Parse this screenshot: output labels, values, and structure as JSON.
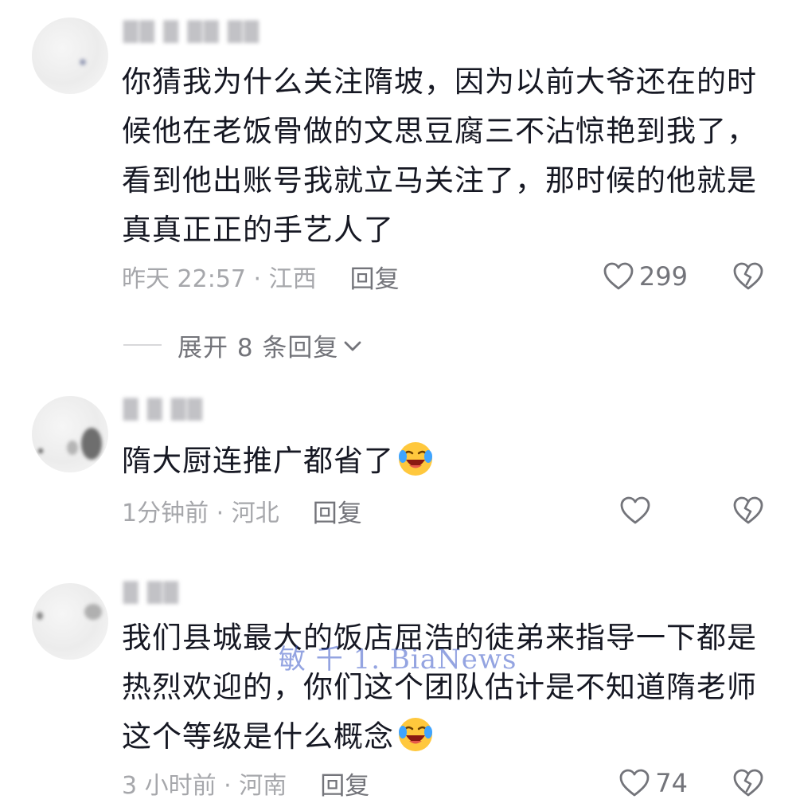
{
  "comments": [
    {
      "username": "██ █ ██ ██",
      "lines": [
        "你猜我为什么关注隋坡，因为以前大爷还在的时",
        "候他在老饭骨做的文思豆腐三不沾惊艳到我了，",
        "看到他出账号我就立马关注了，那时候的他就是",
        "真真正正的手艺人了"
      ],
      "time_location": "昨天 22:57 · 江西",
      "reply_label": "回复",
      "like_count": "299"
    },
    {
      "username": "█ █ ██",
      "lines": [
        "隋大厨连推广都省了"
      ],
      "time_location": "1分钟前 · 河北",
      "reply_label": "回复",
      "like_count": ""
    },
    {
      "username": "█ ██",
      "lines": [
        "我们县城最大的饭店屈浩的徒弟来指导一下都是",
        "热烈欢迎的，你们这个团队估计是不知道隋老师",
        "这个等级是什么概念"
      ],
      "time_location": "3 小时前 · 河南",
      "reply_label": "回复",
      "like_count": "74"
    }
  ],
  "expand_replies_label": "展开 8 条回复",
  "watermark": "敏 千 1. BiaNews",
  "icons": {
    "like": "heart-outline-icon",
    "dislike": "broken-heart-icon",
    "emoji": "laughing-crying-emoji-icon",
    "expand": "chevron-down-icon"
  },
  "colors": {
    "text_primary": "#161823",
    "text_meta": "#a6a7ab",
    "text_action": "#73747a"
  }
}
